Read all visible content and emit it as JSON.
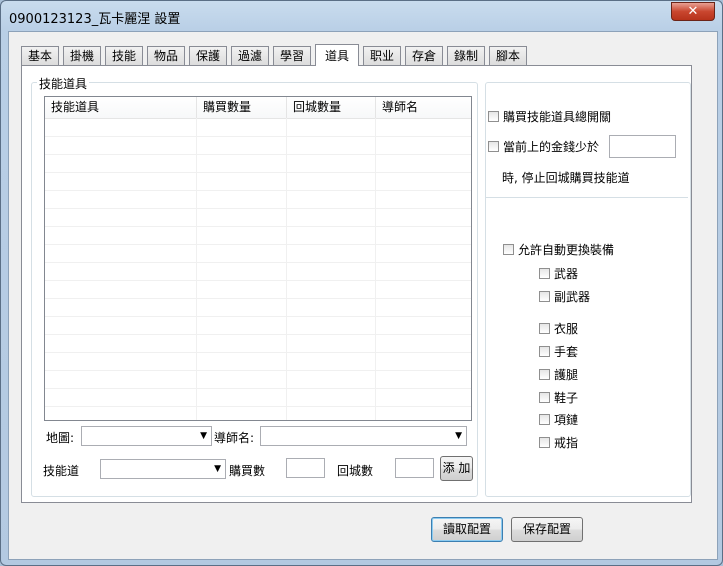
{
  "window": {
    "title": "0900123123_瓦卡麗涅  設置",
    "close_symbol": "✕"
  },
  "tabs": [
    {
      "label": "基本"
    },
    {
      "label": "掛機"
    },
    {
      "label": "技能"
    },
    {
      "label": "物品"
    },
    {
      "label": "保護"
    },
    {
      "label": "過濾"
    },
    {
      "label": "學習"
    },
    {
      "label": "道具",
      "active": true
    },
    {
      "label": "职业"
    },
    {
      "label": "存倉"
    },
    {
      "label": "錄制"
    },
    {
      "label": "腳本"
    }
  ],
  "skill_items": {
    "group_title": "技能道具",
    "columns": [
      "技能道具",
      "購買數量",
      "回城數量",
      "導師名"
    ],
    "rows": [],
    "map_label": "地圖:",
    "map_value": "",
    "mentor_label": "導師名:",
    "mentor_value": "",
    "skill_item_label": "技能道",
    "skill_item_value": "",
    "buy_count_label": "購買數",
    "buy_count_value": "",
    "return_count_label": "回城數",
    "return_count_value": "",
    "add_button": "添 加"
  },
  "right_panel": {
    "master_switch": {
      "label": "購買技能道具總開關",
      "checked": false
    },
    "money_check": {
      "label": "當前上的金錢少於",
      "checked": false,
      "value": ""
    },
    "money_suffix": "時, 停止回城購買技能道",
    "auto_equip": {
      "label": "允許自動更換裝備",
      "checked": false
    },
    "equip_group1": [
      {
        "label": "武器",
        "checked": false
      },
      {
        "label": "副武器",
        "checked": false
      }
    ],
    "equip_group2": [
      {
        "label": "衣服",
        "checked": false
      },
      {
        "label": "手套",
        "checked": false
      },
      {
        "label": "護腿",
        "checked": false
      },
      {
        "label": "鞋子",
        "checked": false
      },
      {
        "label": "項鏈",
        "checked": false
      },
      {
        "label": "戒指",
        "checked": false
      }
    ]
  },
  "footer": {
    "read_button": "讀取配置",
    "save_button": "保存配置"
  }
}
